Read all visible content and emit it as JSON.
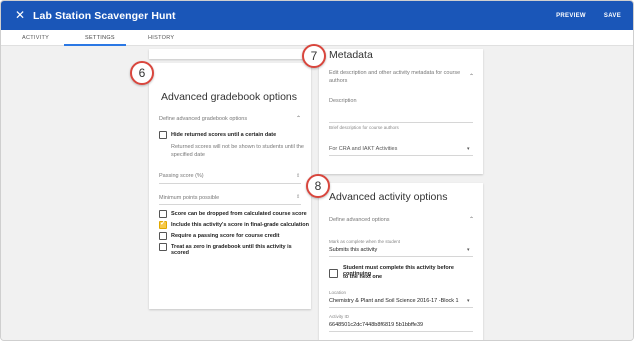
{
  "app": {
    "close_glyph": "✕",
    "title": "Lab Station Scavenger Hunt",
    "preview_label": "PREVIEW",
    "save_label": "SAVE",
    "accent_color": "#1a56b8"
  },
  "tabs": [
    {
      "label": "ACTIVITY",
      "selected": false
    },
    {
      "label": "SETTINGS",
      "selected": true
    },
    {
      "label": "HISTORY",
      "selected": false
    }
  ],
  "callouts": [
    "6",
    "7",
    "8"
  ],
  "gradebook": {
    "title": "Advanced gradebook options",
    "section_label": "Define advanced gradebook options",
    "chevron": "⌃",
    "hide_scores": {
      "label": "Hide returned scores until a certain date",
      "note_line1": "Returned scores will not be shown to students until the",
      "note_line2": "specified date",
      "checked": false
    },
    "passing_score_label": "Passing score (%)",
    "min_points_label": "Minimum points possible",
    "spinner": "⇕",
    "options": [
      {
        "label": "Score can be dropped from calculated course score",
        "checked": false
      },
      {
        "label": "Include this activity's score in final-grade calculation",
        "checked": true
      },
      {
        "label": "Require a passing score for course credit",
        "checked": false
      },
      {
        "label": "Treat as zero in gradebook until this activity is scored",
        "checked": false
      }
    ]
  },
  "metadata": {
    "title": "Metadata",
    "section_line1": "Edit description and other activity metadata for course",
    "section_line2": "authors",
    "chevron": "⌃",
    "description_label": "Description",
    "description_hint": "Brief description for course authors",
    "dropdown_value": "For CRA and IAKT Activities",
    "dropdown_arrow": "▾"
  },
  "advanced_activity": {
    "title": "Advanced activity options",
    "section_label": "Define advanced options",
    "chevron": "⌃",
    "complete_label": "Mark as complete when the student",
    "complete_value": "Submits this activity",
    "dropdown_arrow": "▾",
    "must_complete_line1": "Student must complete this activity before continuing",
    "must_complete_line2": "to the next one",
    "must_complete_checked": false,
    "location_label": "Location",
    "location_value": "Chemistry & Plant and Soil Science 2016-17 -Block 1",
    "activity_id_label": "Activity ID",
    "activity_id_value": "6648501c2dc7448b8f6819 5b1bbffe39"
  }
}
